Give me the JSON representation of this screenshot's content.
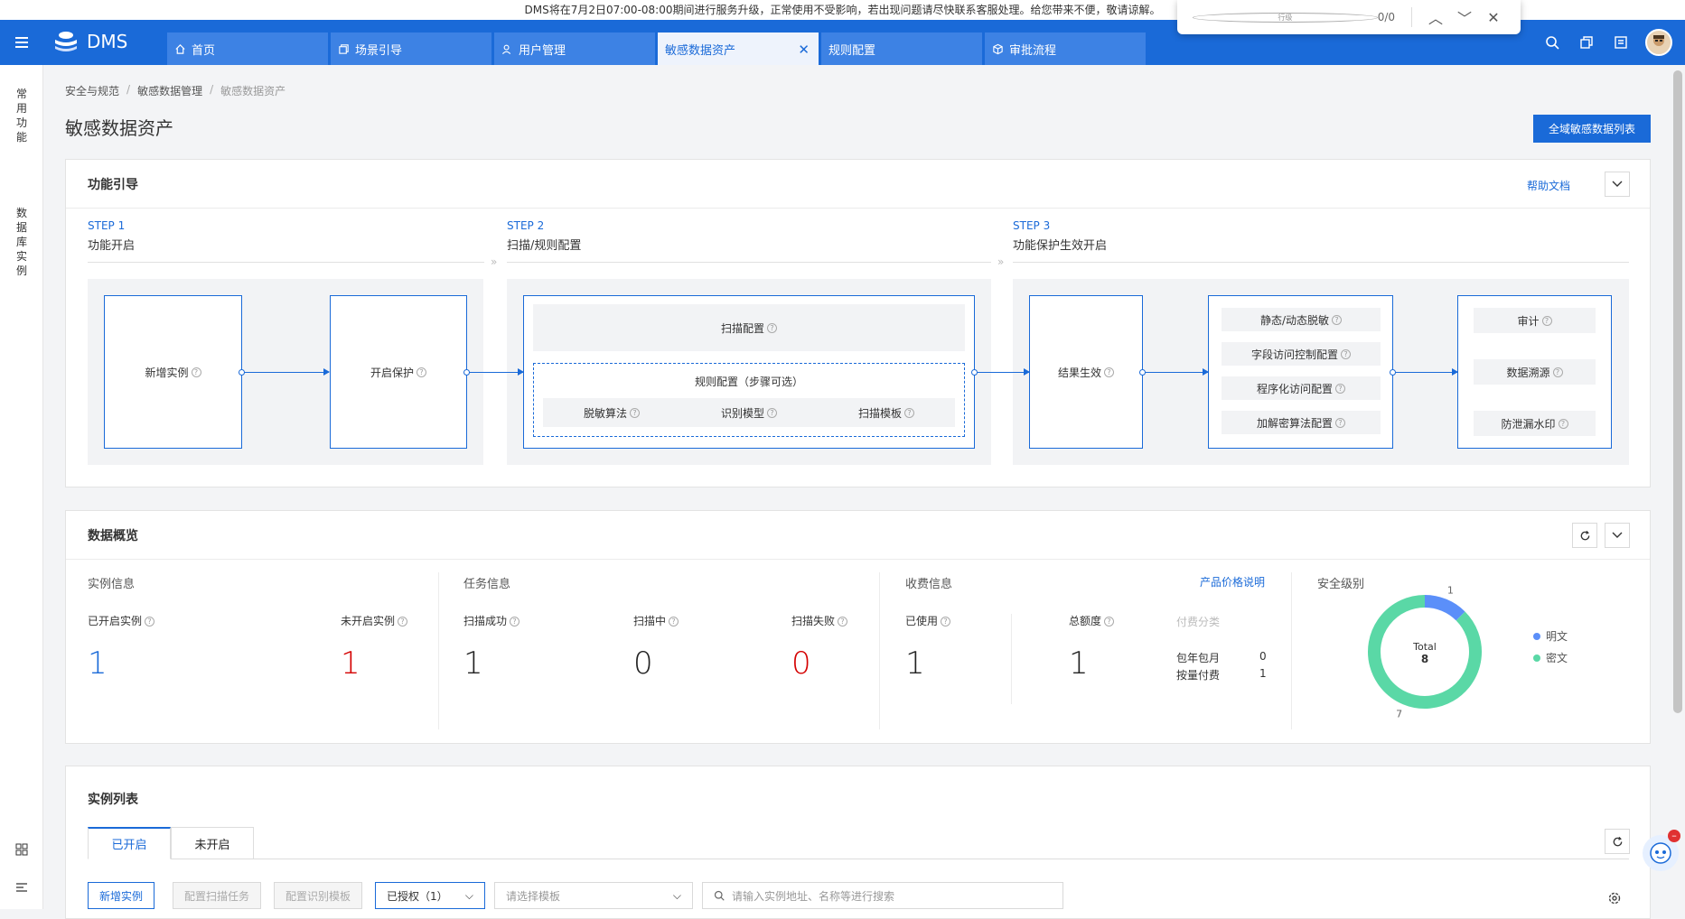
{
  "notice": "DMS将在7月2日07:00-08:00期间进行服务升级，正常使用不受影响，若出现问题请尽快联系客服处理。给您带来不便，敬请谅解。",
  "header": {
    "logo_text": "DMS",
    "tabs": [
      {
        "label": "首页",
        "icon": "home-icon"
      },
      {
        "label": "场景引导",
        "icon": "layers-icon"
      },
      {
        "label": "用户管理",
        "icon": "user-icon"
      },
      {
        "label": "敏感数据资产",
        "icon": "",
        "active": true
      },
      {
        "label": "规则配置",
        "icon": ""
      },
      {
        "label": "审批流程",
        "icon": "cube-icon"
      }
    ],
    "accent": "#1a6ad8"
  },
  "findbar": {
    "query": "行级",
    "count": "0/0"
  },
  "rail": {
    "item1": "常用功能",
    "item2": "数据库实例"
  },
  "breadcrumb": [
    "安全与规范",
    "敏感数据管理",
    "敏感数据资产"
  ],
  "page_title": "敏感数据资产",
  "global_list_button": "全域敏感数据列表",
  "guide": {
    "title": "功能引导",
    "help": "帮助文档",
    "steps": [
      {
        "num": "STEP 1",
        "title": "功能开启"
      },
      {
        "num": "STEP 2",
        "title": "扫描/规则配置"
      },
      {
        "num": "STEP 3",
        "title": "功能保护生效开启"
      }
    ],
    "new_instance": "新增实例",
    "enable_protect": "开启保护",
    "scan_config": "扫描配置",
    "rule_config": "规则配置（步骤可选）",
    "desens_algo": "脱敏算法",
    "recog_model": "识别模型",
    "scan_template": "扫描模板",
    "result_effect": "结果生效",
    "static_dynamic": "静态/动态脱敏",
    "field_access": "字段访问控制配置",
    "program_access": "程序化访问配置",
    "crypto_config": "加解密算法配置",
    "audit": "审计",
    "data_trace": "数据溯源",
    "watermark": "防泄漏水印"
  },
  "overview": {
    "title": "数据概览",
    "instance_info": "实例信息",
    "opened_instances": "已开启实例",
    "opened_value": "1",
    "unopened_instances": "未开启实例",
    "unopened_value": "1",
    "task_info": "任务信息",
    "scan_success": "扫描成功",
    "scan_success_value": "1",
    "scanning": "扫描中",
    "scanning_value": "0",
    "scan_failed": "扫描失败",
    "scan_failed_value": "0",
    "billing_info": "收费信息",
    "price_link": "产品价格说明",
    "used": "已使用",
    "used_value": "1",
    "total_quota": "总额度",
    "total_quota_value": "1",
    "billing_type": "付费分类",
    "subscription": "包年包月",
    "subscription_value": "0",
    "pay_as_go": "按量付费",
    "pay_as_go_value": "1",
    "security_level": "安全级别",
    "donut_total_label": "Total",
    "donut_total_value": "8",
    "colors": {
      "blue": "#1a6ad8",
      "red": "#d40000"
    }
  },
  "chart_data": {
    "type": "pie",
    "categories": [
      "明文",
      "密文"
    ],
    "values": [
      1,
      7
    ],
    "colors": [
      "#5b8ff9",
      "#5ad8a6"
    ],
    "total": 8
  },
  "instances": {
    "title": "实例列表",
    "tabs": [
      "已开启",
      "未开启"
    ],
    "new_instance": "新增实例",
    "config_scan_task": "配置扫描任务",
    "config_recog_template": "配置识别模板",
    "authorized": "已授权（1）",
    "template_placeholder": "请选择模板",
    "search_placeholder": "请输入实例地址、名称等进行搜索"
  }
}
